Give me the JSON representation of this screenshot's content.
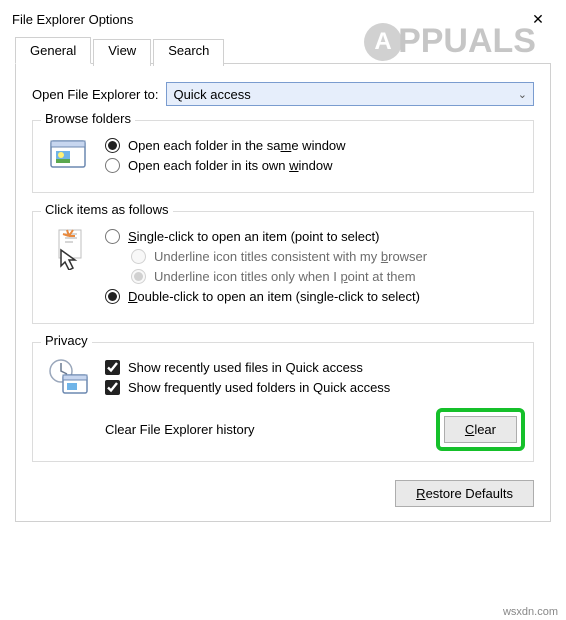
{
  "window": {
    "title": "File Explorer Options",
    "close_glyph": "✕"
  },
  "tabs": {
    "general": "General",
    "view": "View",
    "search": "Search"
  },
  "open_row": {
    "label": "Open File Explorer to:",
    "value": "Quick access"
  },
  "browse": {
    "legend": "Browse folders",
    "same_pre": "Open each folder in the sa",
    "same_u": "m",
    "same_post": "e window",
    "own_pre": "Open each folder in its own ",
    "own_u": "w",
    "own_post": "indow"
  },
  "click": {
    "legend": "Click items as follows",
    "single_u": "S",
    "single_post": "ingle-click to open an item (point to select)",
    "ul_browser_pre": "Underline icon titles consistent with my ",
    "ul_browser_u": "b",
    "ul_browser_post": "rowser",
    "ul_point_pre": "Underline icon titles only when I ",
    "ul_point_u": "p",
    "ul_point_post": "oint at them",
    "double_u": "D",
    "double_post": "ouble-click to open an item (single-click to select)"
  },
  "privacy": {
    "legend": "Privacy",
    "recent": "Show recently used files in Quick access",
    "frequent": "Show frequently used folders in Quick access",
    "clear_label": "Clear File Explorer history",
    "clear_btn_u": "C",
    "clear_btn_post": "lear"
  },
  "footer": {
    "restore_u": "R",
    "restore_post": "estore Defaults"
  },
  "watermark": {
    "text": "PPUALS"
  },
  "attrib": "wsxdn.com"
}
